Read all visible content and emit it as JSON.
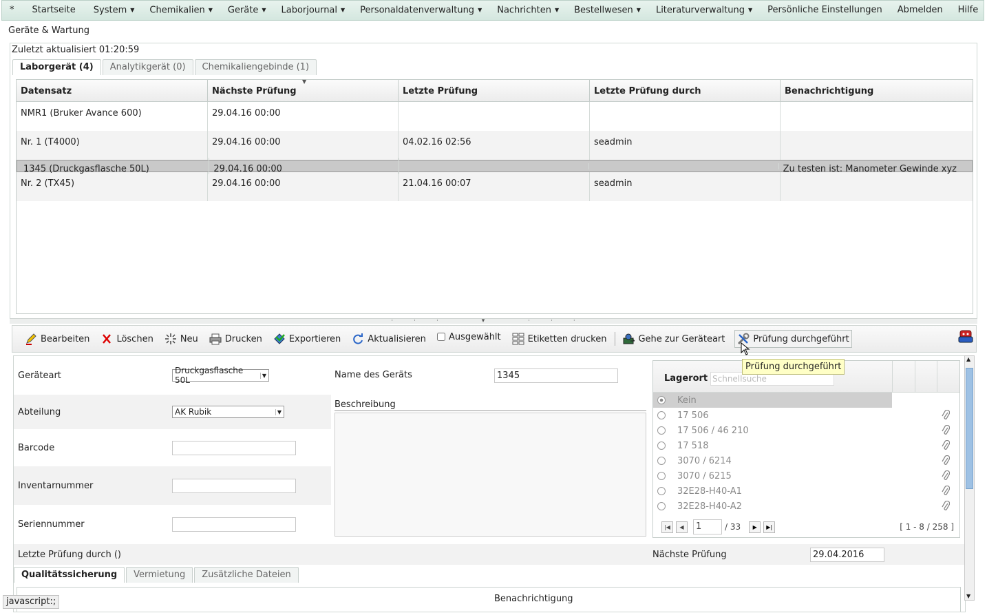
{
  "menu": {
    "items": [
      {
        "label": "*",
        "caret": false
      },
      {
        "label": "Startseite",
        "caret": false
      },
      {
        "label": "System",
        "caret": true
      },
      {
        "label": "Chemikalien",
        "caret": true
      },
      {
        "label": "Geräte",
        "caret": true
      },
      {
        "label": "Laborjournal",
        "caret": true
      },
      {
        "label": "Personaldatenverwaltung",
        "caret": true
      },
      {
        "label": "Nachrichten",
        "caret": true
      },
      {
        "label": "Bestellwesen",
        "caret": true
      },
      {
        "label": "Literaturverwaltung",
        "caret": true
      },
      {
        "label": "Persönliche Einstellungen",
        "caret": false
      },
      {
        "label": "Abmelden",
        "caret": false
      },
      {
        "label": "Hilfe",
        "caret": false
      }
    ]
  },
  "page_title": "Geräte & Wartung",
  "last_updated": "Zuletzt aktualisiert 01:20:59",
  "top_tabs": [
    "Laborgerät (4)",
    "Analytikgerät (0)",
    "Chemikaliengebinde (1)"
  ],
  "grid": {
    "headers": [
      "Datensatz",
      "Nächste Prüfung",
      "Letzte Prüfung",
      "Letzte Prüfung durch",
      "Benachrichtigung"
    ],
    "rows": [
      [
        "NMR1 (Bruker Avance 600)",
        "29.04.16 00:00",
        "",
        "",
        ""
      ],
      [
        "Nr. 1 (T4000)",
        "29.04.16 00:00",
        "04.02.16 02:56",
        "seadmin",
        ""
      ],
      [
        "1345 (Druckgasflasche 50L)",
        "29.04.16 00:00",
        "",
        "",
        "Zu testen ist: Manometer Gewinde xyz"
      ],
      [
        "Nr. 2 (TX45)",
        "29.04.16 00:00",
        "21.04.16 00:07",
        "seadmin",
        ""
      ]
    ]
  },
  "toolbar": {
    "edit": "Bearbeiten",
    "delete": "Löschen",
    "new": "Neu",
    "print": "Drucken",
    "export": "Exportieren",
    "refresh": "Aktualisieren",
    "selected": "Ausgewählt",
    "labels": "Etiketten drucken",
    "goto_type": "Gehe zur Geräteart",
    "test_done": "Prüfung durchgeführt"
  },
  "tooltip": "Prüfung durchgeführt",
  "form": {
    "type_label": "Geräteart",
    "type_value": "Druckgasflasche 50L",
    "dept_label": "Abteilung",
    "dept_value": "AK Rubik",
    "barcode_label": "Barcode",
    "inventory_label": "Inventarnummer",
    "serial_label": "Seriennummer",
    "name_label": "Name des Geräts",
    "name_value": "1345",
    "desc_label": "Beschreibung",
    "last_by_label": "Letzte Prüfung durch ()",
    "next_label": "Nächste Prüfung",
    "next_value": "29.04.2016"
  },
  "lager": {
    "title": "Lagerort",
    "search_placeholder": "Schnellsuche",
    "items": [
      "Kein",
      "17 506",
      "17 506 / 46 210",
      "17 518",
      "3070 / 6214",
      "3070 / 6215",
      "32E28-H40-A1",
      "32E28-H40-A2"
    ],
    "page": "1",
    "pages": "/ 33",
    "range": "[ 1 - 8 / 258 ]"
  },
  "bottom_tabs": [
    "Qualitätssicherung",
    "Vermietung",
    "Zusätzliche Dateien"
  ],
  "benachrichtigung": "Benachrichtigung",
  "status": "javascript:;"
}
